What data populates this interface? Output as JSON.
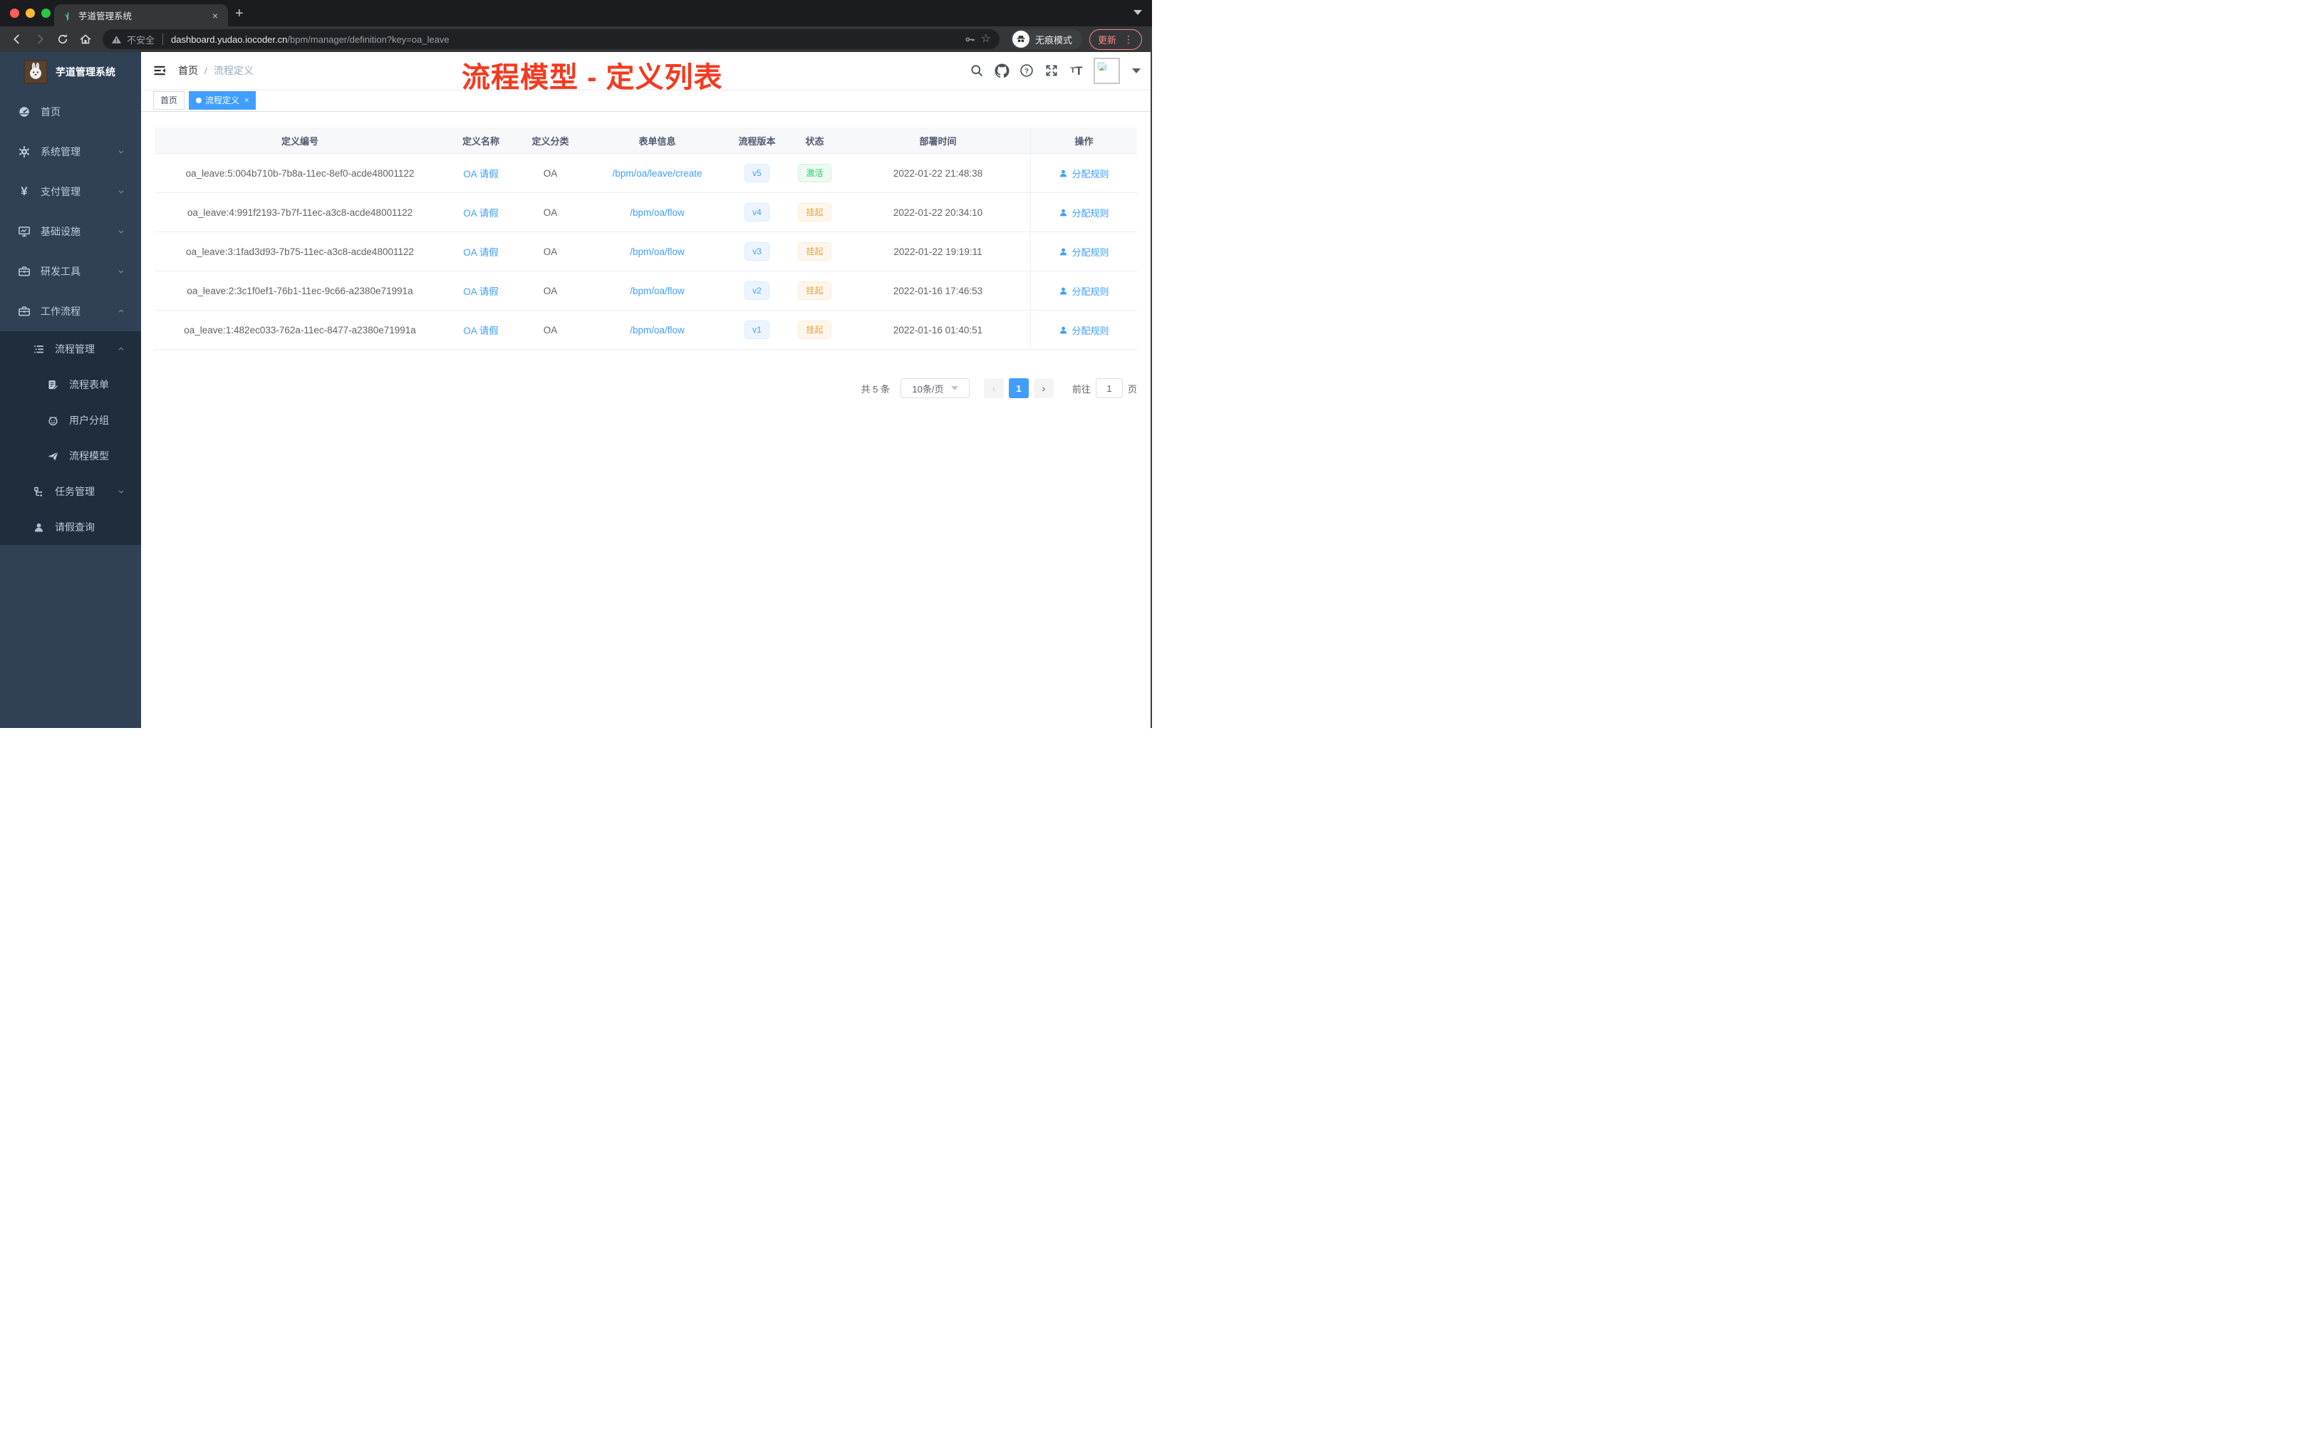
{
  "browser": {
    "tab_title": "芋道管理系统",
    "close_glyph": "×",
    "new_tab_glyph": "+",
    "address": {
      "security_label": "不安全",
      "host": "dashboard.yudao.iocoder.cn",
      "path": "/bpm/manager/definition?key=oa_leave",
      "star_glyph": "☆"
    },
    "incognito_label": "无痕模式",
    "update_label": "更新",
    "kebab_glyph": "⋮"
  },
  "sidebar": {
    "title": "芋道管理系统",
    "items": [
      {
        "label": "首页",
        "icon": "dashboard-icon"
      },
      {
        "label": "系统管理",
        "icon": "gear-icon"
      },
      {
        "label": "支付管理",
        "icon": "yen-icon",
        "yen": "¥"
      },
      {
        "label": "基础设施",
        "icon": "monitor-icon"
      },
      {
        "label": "研发工具",
        "icon": "toolbox-icon"
      },
      {
        "label": "工作流程",
        "icon": "briefcase-icon"
      },
      {
        "label": "流程管理",
        "icon": "tree-table-icon"
      },
      {
        "label": "流程表单",
        "icon": "form-icon"
      },
      {
        "label": "用户分组",
        "icon": "robot-icon"
      },
      {
        "label": "流程模型",
        "icon": "paper-plane-icon"
      },
      {
        "label": "任务管理",
        "icon": "tree-icon"
      },
      {
        "label": "请假查询",
        "icon": "user-icon"
      }
    ]
  },
  "navbar": {
    "breadcrumb": [
      "首页",
      "流程定义"
    ],
    "separator": "/",
    "annotation": "流程模型 - 定义列表"
  },
  "tags": [
    {
      "label": "首页"
    },
    {
      "label": "流程定义",
      "close": "×"
    }
  ],
  "table": {
    "columns": [
      "定义编号",
      "定义名称",
      "定义分类",
      "表单信息",
      "流程版本",
      "状态",
      "部署时间",
      "操作"
    ],
    "rows": [
      {
        "id": "oa_leave:5:004b710b-7b8a-11ec-8ef0-acde48001122",
        "name": "OA 请假",
        "category": "OA",
        "form": "/bpm/oa/leave/create",
        "version": "v5",
        "status": "激活",
        "time": "2022-01-22 21:48:38",
        "action": "分配规则"
      },
      {
        "id": "oa_leave:4:991f2193-7b7f-11ec-a3c8-acde48001122",
        "name": "OA 请假",
        "category": "OA",
        "form": "/bpm/oa/flow",
        "version": "v4",
        "status": "挂起",
        "time": "2022-01-22 20:34:10",
        "action": "分配规则"
      },
      {
        "id": "oa_leave:3:1fad3d93-7b75-11ec-a3c8-acde48001122",
        "name": "OA 请假",
        "category": "OA",
        "form": "/bpm/oa/flow",
        "version": "v3",
        "status": "挂起",
        "time": "2022-01-22 19:19:11",
        "action": "分配规则"
      },
      {
        "id": "oa_leave:2:3c1f0ef1-76b1-11ec-9c66-a2380e71991a",
        "name": "OA 请假",
        "category": "OA",
        "form": "/bpm/oa/flow",
        "version": "v2",
        "status": "挂起",
        "time": "2022-01-16 17:46:53",
        "action": "分配规则"
      },
      {
        "id": "oa_leave:1:482ec033-762a-11ec-8477-a2380e71991a",
        "name": "OA 请假",
        "category": "OA",
        "form": "/bpm/oa/flow",
        "version": "v1",
        "status": "挂起",
        "time": "2022-01-16 01:40:51",
        "action": "分配规则"
      }
    ]
  },
  "pagination": {
    "total": "共 5 条",
    "page_size": "10条/页",
    "prev": "‹",
    "page": "1",
    "next": "›",
    "goto_label": "前往",
    "goto_value": "1",
    "unit": "页"
  },
  "colors": {
    "accent": "#409eff",
    "sidebar_bg": "#304156",
    "submenu_bg": "#1f2d3d",
    "status_active": "#2dc96e",
    "status_suspended": "#e6a23c",
    "annotation_red": "#f43a20"
  }
}
